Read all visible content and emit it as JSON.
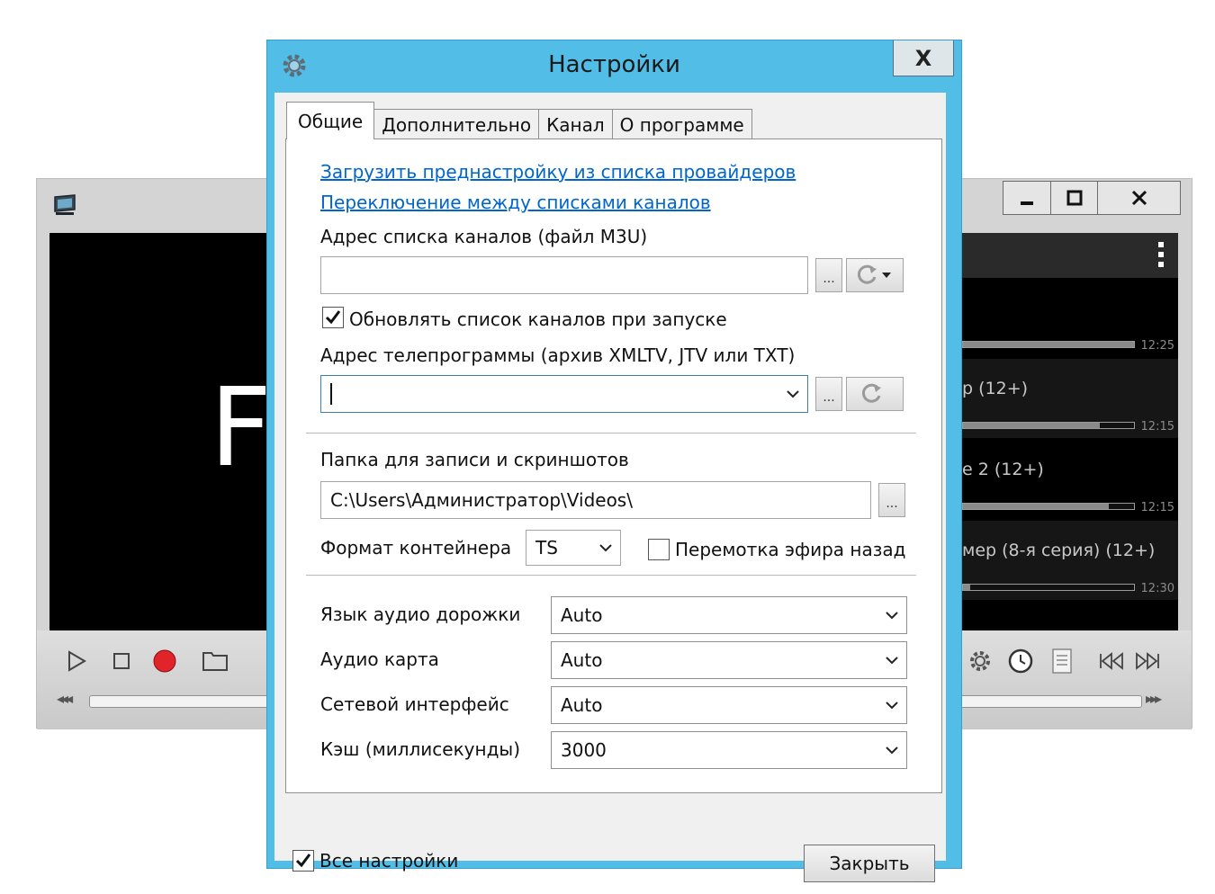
{
  "player": {
    "video_text": "F",
    "playlist": [
      {
        "title": "",
        "time": "12:25",
        "progress": 1.0
      },
      {
        "title": "р (12+)",
        "time": "12:15",
        "progress": 0.8
      },
      {
        "title": "е 2 (12+)",
        "time": "12:15",
        "progress": 0.85
      },
      {
        "title": "мер (8-я серия) (12+)",
        "time": "12:30",
        "progress": 0.04
      }
    ]
  },
  "dialog": {
    "title": "Настройки",
    "close_label": "X",
    "tabs": [
      {
        "label": "Общие",
        "active": true
      },
      {
        "label": "Дополнительно",
        "active": false
      },
      {
        "label": "Канал",
        "active": false
      },
      {
        "label": "О программе",
        "active": false
      }
    ],
    "general": {
      "link_preset": "Загрузить преднастройку из списка провайдеров",
      "link_switch": "Переключение между списками каналов",
      "m3u_label": "Адрес списка каналов (файл M3U)",
      "m3u_value": "",
      "browse_label": "...",
      "update_on_start_label": "Обновлять список каналов при запуске",
      "update_on_start_checked": true,
      "epg_label": "Адрес телепрограммы (архив XMLTV, JTV или TXT)",
      "epg_value": "",
      "record_folder_label": "Папка для записи и скриншотов",
      "record_folder_value": "C:\\Users\\Администратор\\Videos\\",
      "container_label": "Формат контейнера",
      "container_value": "TS",
      "timeshift_label": "Перемотка эфира назад",
      "timeshift_checked": false,
      "audio_lang_label": "Язык аудио дорожки",
      "audio_lang_value": "Auto",
      "audio_card_label": "Аудио карта",
      "audio_card_value": "Auto",
      "network_label": "Сетевой интерфейс",
      "network_value": "Auto",
      "cache_label": "Кэш (миллисекунды)",
      "cache_value": "3000"
    },
    "all_settings_label": "Все настройки",
    "all_settings_checked": true,
    "close_button": "Закрыть"
  },
  "colors": {
    "dialog_frame": "#52bde7",
    "link": "#0066cc",
    "record": "#e0242a"
  }
}
